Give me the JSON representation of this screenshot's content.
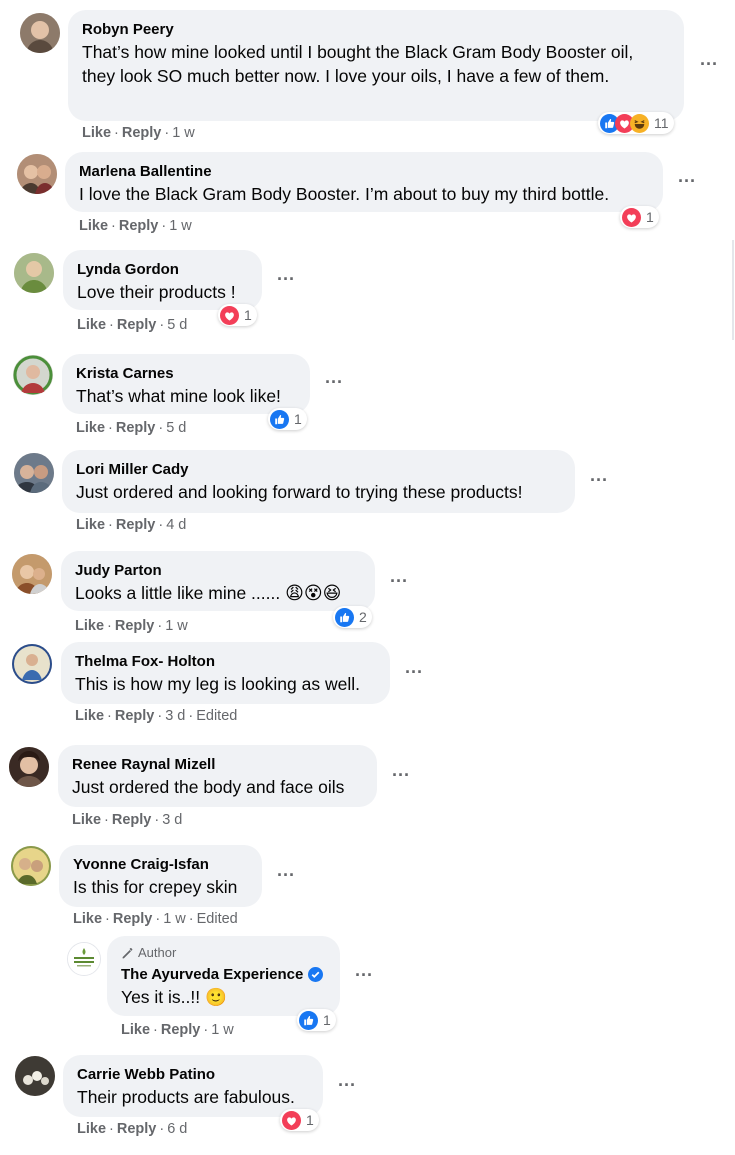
{
  "colors": {
    "bubble": "#f0f2f5",
    "meta": "#65676b",
    "like_blue": "#1877f2",
    "love_red": "#f33e58"
  },
  "icons": {
    "like": "like-reaction-icon",
    "love": "love-reaction-icon",
    "haha": "haha-reaction-icon",
    "more": "more-options-icon",
    "pencil": "pencil-icon",
    "verified": "verified-badge-icon"
  },
  "comments": [
    {
      "name": "Robyn Peery",
      "text": "That’s how mine looked until I bought the Black Gram Body Booster oil, they look SO much better now. I love your oils, I have a few of them.",
      "like": "Like",
      "reply": "Reply",
      "time": "1 w",
      "reaction_count": "11"
    },
    {
      "name": "Marlena Ballentine",
      "text": "I love the Black Gram Body Booster. I’m about to buy my third bottle.",
      "like": "Like",
      "reply": "Reply",
      "time": "1 w",
      "reaction_count": "1"
    },
    {
      "name": "Lynda Gordon",
      "text": "Love their products !",
      "like": "Like",
      "reply": "Reply",
      "time": "5 d",
      "reaction_count": "1"
    },
    {
      "name": "Krista Carnes",
      "text": "That’s what mine look like!",
      "like": "Like",
      "reply": "Reply",
      "time": "5 d",
      "reaction_count": "1"
    },
    {
      "name": "Lori Miller Cady",
      "text": "Just ordered and looking forward to trying these products!",
      "like": "Like",
      "reply": "Reply",
      "time": "4 d"
    },
    {
      "name": "Judy Parton",
      "text": "Looks a little like mine ......",
      "emojis": "😩😵😆",
      "like": "Like",
      "reply": "Reply",
      "time": "1 w",
      "reaction_count": "2"
    },
    {
      "name": "Thelma Fox- Holton",
      "text": "This is how my leg is looking as well.",
      "like": "Like",
      "reply": "Reply",
      "time": "3 d",
      "edited": "Edited"
    },
    {
      "name": "Renee Raynal Mizell",
      "text": "Just ordered the body and face oils",
      "like": "Like",
      "reply": "Reply",
      "time": "3 d"
    },
    {
      "name": "Yvonne Craig-Isfan",
      "text": "Is this for crepey skin",
      "like": "Like",
      "reply": "Reply",
      "time": "1 w",
      "edited": "Edited"
    },
    {
      "author_label": "Author",
      "name": "The Ayurveda Experience",
      "text": "Yes it is..!! 🙂",
      "like": "Like",
      "reply": "Reply",
      "time": "1 w",
      "reaction_count": "1"
    },
    {
      "name": "Carrie Webb Patino",
      "text": "Their products are fabulous.",
      "like": "Like",
      "reply": "Reply",
      "time": "6 d",
      "reaction_count": "1"
    }
  ]
}
